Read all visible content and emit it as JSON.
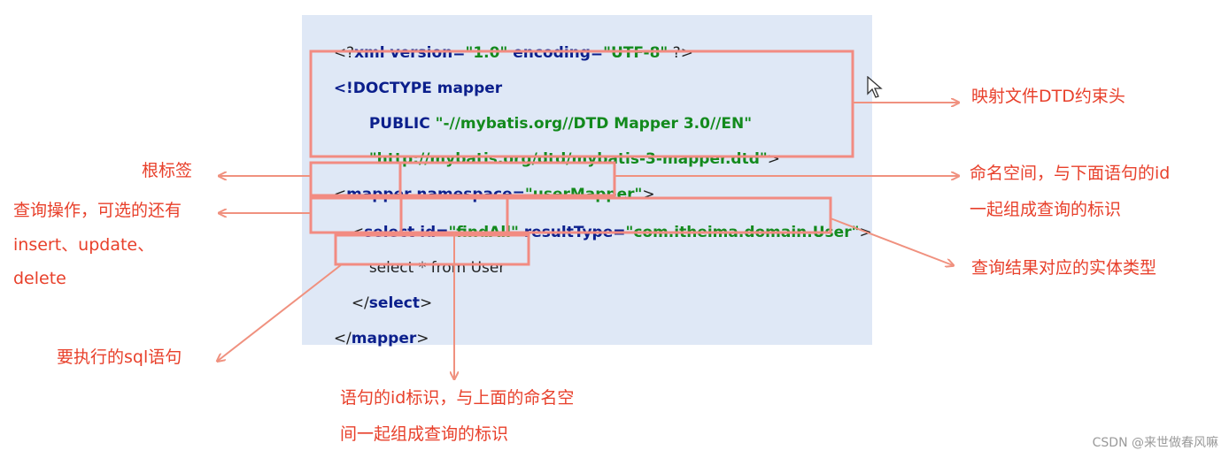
{
  "code": {
    "xml_open": "<?",
    "xml_decl": "xml version=",
    "xml_version": "\"1.0\"",
    "xml_encoding_attr": " encoding=",
    "xml_encoding": "\"UTF-8\"",
    "xml_close": " ?>",
    "doctype_open": "<!DOCTYPE mapper",
    "public_kw": "PUBLIC ",
    "public_id": "\"-//mybatis.org//DTD Mapper 3.0//EN\"",
    "system_id": "\"http://mybatis.org/dtd/mybatis-3-mapper.dtd\"",
    "doctype_close": ">",
    "mapper_open_lt": "<",
    "mapper_tag": "mapper",
    "namespace_attr": " namespace=",
    "namespace_value": "\"userMapper\"",
    "mapper_open_gt": ">",
    "select_open_lt": "<",
    "select_tag": "select",
    "id_attr": " id=",
    "id_value": "\"findAll\"",
    "result_attr": " resultType=",
    "result_value": "\"com.itheima.domain.User\"",
    "select_open_gt": ">",
    "sql": "select * from User",
    "select_close_lt": "</",
    "select_close_tag": "select",
    "select_close_gt": ">",
    "mapper_close_lt": "</",
    "mapper_close_tag": "mapper",
    "mapper_close_gt": ">"
  },
  "annotations": {
    "dtd_header": "映射文件DTD约束头",
    "root_tag": "根标签",
    "query_op_1": "查询操作，可选的还有",
    "query_op_2": "insert、update、",
    "query_op_3": "delete",
    "namespace_1": "命名空间，与下面语句的id",
    "namespace_2": "一起组成查询的标识",
    "result_type": "查询结果对应的实体类型",
    "sql_statement": "要执行的sql语句",
    "statement_id_1": "语句的id标识，与上面的命名空",
    "statement_id_2": "间一起组成查询的标识"
  },
  "watermark": "CSDN @来世做春风嘛",
  "colors": {
    "panel_bg": "#dfe8f6",
    "highlight_box": "#f28b82",
    "arrow": "#f0917f",
    "label_text": "#e8402b",
    "keyword": "#0b1f8c",
    "string": "#138a1d"
  },
  "icons": {
    "cursor": "mouse-pointer-icon"
  }
}
